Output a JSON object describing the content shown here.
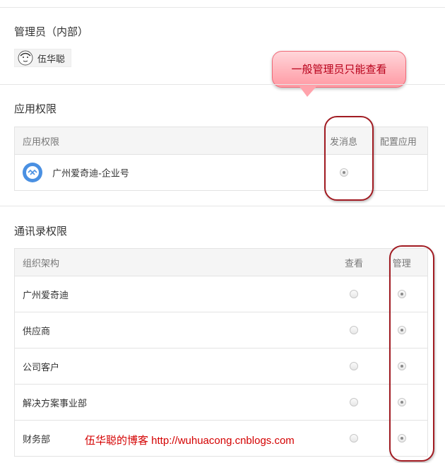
{
  "admin": {
    "section_title": "管理员（内部）",
    "user_name": "伍华聪"
  },
  "callout": {
    "text": "一般管理员只能查看"
  },
  "app_permissions": {
    "section_title": "应用权限",
    "columns": [
      "应用权限",
      "发消息",
      "配置应用"
    ],
    "rows": [
      {
        "name": "广州爱奇迪-企业号",
        "send_message": true,
        "configure_app": null
      }
    ]
  },
  "contacts_permissions": {
    "section_title": "通讯录权限",
    "columns": [
      "组织架构",
      "查看",
      "管理"
    ],
    "rows": [
      {
        "name": "广州爱奇迪",
        "view": false,
        "manage": true
      },
      {
        "name": "供应商",
        "view": false,
        "manage": true
      },
      {
        "name": "公司客户",
        "view": false,
        "manage": true
      },
      {
        "name": "解决方案事业部",
        "view": false,
        "manage": true
      },
      {
        "name": "财务部",
        "view": false,
        "manage": true
      }
    ]
  },
  "watermark": {
    "text": "伍华聪的博客 http://wuhuacong.cnblogs.com"
  },
  "colors": {
    "callout_text": "#b8001a",
    "oval_border": "#a11b22",
    "watermark": "#d40000",
    "app_icon": "#4a90e2"
  }
}
